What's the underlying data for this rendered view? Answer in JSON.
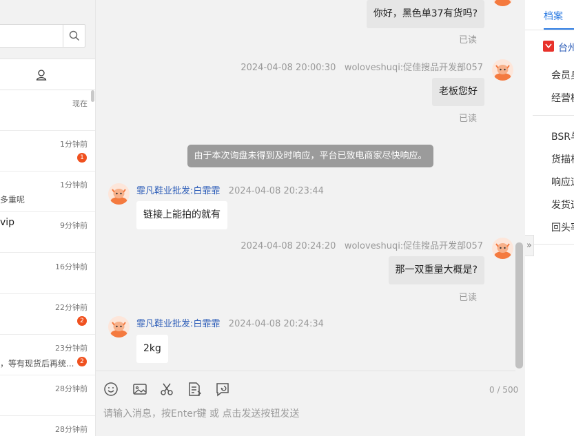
{
  "search": {
    "placeholder": ""
  },
  "conversation_list": {
    "items": [
      {
        "time": "现在",
        "preview": "",
        "name": "",
        "badge": ""
      },
      {
        "time": "1分钟前",
        "preview": "",
        "name": "",
        "badge": "1"
      },
      {
        "time": "1分钟前",
        "preview": "多重呢",
        "name": "",
        "badge": ""
      },
      {
        "time": "9分钟前",
        "preview": "",
        "name": "vip",
        "badge": ""
      },
      {
        "time": "16分钟前",
        "preview": "",
        "name": "",
        "badge": ""
      },
      {
        "time": "22分钟前",
        "preview": "",
        "name": "",
        "badge": "2"
      },
      {
        "time": "23分钟前",
        "preview": "，等有现货后再统...",
        "name": "",
        "badge": "2"
      },
      {
        "time": "28分钟前",
        "preview": "",
        "name": "",
        "badge": ""
      },
      {
        "time": "28分钟前",
        "preview": "",
        "name": "",
        "badge": ""
      }
    ]
  },
  "chat": {
    "messages": [
      {
        "text": "你好，黑色单37有货吗?",
        "read": "已读"
      },
      {
        "meta_time": "2024-04-08 20:00:30",
        "meta_sender": "woloveshuqi:促佳搜品开发部057",
        "text": "老板您好",
        "read": "已读"
      },
      {
        "system": "由于本次询盘未得到及时响应，平台已致电商家尽快响应。"
      },
      {
        "meta_sender": "霏凡鞋业批发:白霏霏",
        "meta_time": "2024-04-08 20:23:44",
        "text": "链接上能拍的就有"
      },
      {
        "meta_time": "2024-04-08 20:24:20",
        "meta_sender": "woloveshuqi:促佳搜品开发部057",
        "text": "那一双重量大概是?",
        "read": "已读"
      },
      {
        "meta_sender": "霏凡鞋业批发:白霏霏",
        "meta_time": "2024-04-08 20:24:34",
        "text": "2kg"
      }
    ],
    "counter": "0 / 500",
    "input_placeholder": "请输入消息，按Enter键 或 点击发送按钮发送"
  },
  "right_panel": {
    "tab": "档案",
    "shop_name": "台州",
    "items": [
      "会员身",
      "经营模",
      "BSR与",
      "货描相",
      "响应速",
      "发货速",
      "回头率"
    ],
    "collapse_glyph": "»"
  }
}
